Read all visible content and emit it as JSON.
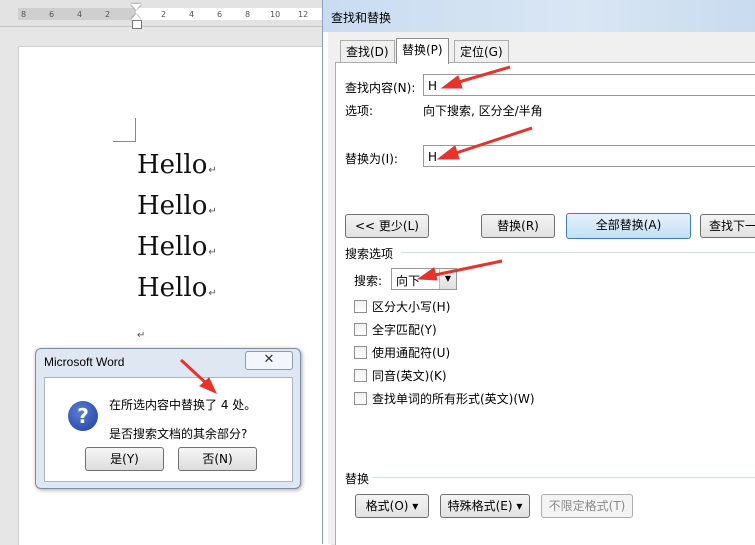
{
  "ruler": {
    "ticks": [
      "8",
      "6",
      "4",
      "2",
      "2",
      "4",
      "6",
      "8",
      "10",
      "12"
    ]
  },
  "document": {
    "lines": [
      "Hello",
      "Hello",
      "Hello",
      "Hello"
    ],
    "para_mark": "↵"
  },
  "message_box": {
    "title": "Microsoft Word",
    "close": "✕",
    "icon": "?",
    "line1": "在所选内容中替换了 4 处。",
    "line2": "是否搜索文档的其余部分?",
    "yes": "是(Y)",
    "no": "否(N)"
  },
  "dialog": {
    "title": "查找和替换",
    "tabs": [
      "查找(D)",
      "替换(P)",
      "定位(G)"
    ],
    "find_label": "查找内容(N):",
    "find_value": "H",
    "options_label": "选项:",
    "options_value": "向下搜索, 区分全/半角",
    "replace_label": "替换为(I):",
    "replace_value": "H",
    "buttons": {
      "less": "<< 更少(L)",
      "replace": "替换(R)",
      "replace_all": "全部替换(A)",
      "find_next": "查找下一"
    },
    "search_options_title": "搜索选项",
    "search_label": "搜索:",
    "search_value": "向下",
    "checkboxes": [
      "区分大小写(H)",
      "全字匹配(Y)",
      "使用通配符(U)",
      "同音(英文)(K)",
      "查找单词的所有形式(英文)(W)"
    ],
    "replace_section_title": "替换",
    "format_buttons": {
      "format": "格式(O) ▾",
      "special": "特殊格式(E) ▾",
      "no_limit": "不限定格式(T)"
    }
  },
  "colors": {
    "annotation_arrow": "#e8332c",
    "dialog_title_bg": "#c9dcf1",
    "msg_bg": "#dfe8f2"
  }
}
